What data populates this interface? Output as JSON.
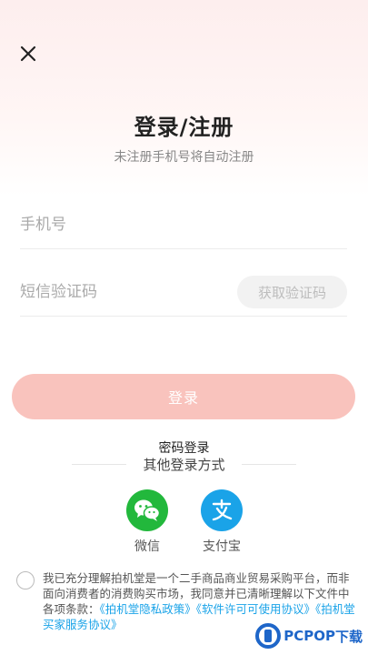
{
  "header": {
    "close_icon": "close-icon",
    "title": "登录/注册",
    "subtitle": "未注册手机号将自动注册"
  },
  "form": {
    "phone_placeholder": "手机号",
    "code_placeholder": "短信验证码",
    "get_code_label": "获取验证码",
    "login_label": "登录",
    "login_color": "#f9c3bd"
  },
  "alt_login": {
    "password_login_label": "密码登录",
    "other_methods_label": "其他登录方式",
    "wechat_label": "微信",
    "wechat_color": "#22b83c",
    "alipay_label": "支付宝",
    "alipay_color": "#1aa3e8"
  },
  "agreement": {
    "text": "我已充分理解拍机堂是一个二手商品商业贸易采购平台，而非面向消费者的消费购买市场，我同意并已清晰理解以下文件中各项条款：",
    "privacy_link": "《拍机堂隐私政策》",
    "license_link": "《软件许可可使用协议》",
    "buyer_link": "《拍机堂买家服务协议》",
    "link_color": "#1aa3e8"
  },
  "watermark": {
    "brand": "PCPOP",
    "suffix": "下载"
  }
}
